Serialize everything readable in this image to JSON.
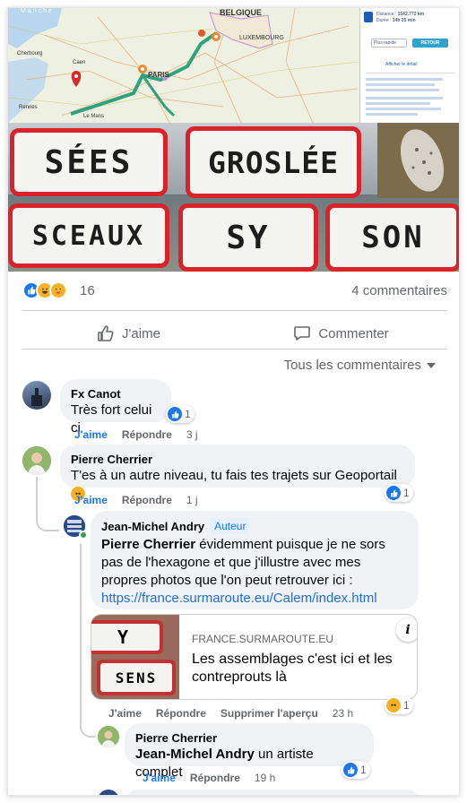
{
  "post": {
    "map_labels": {
      "belgique": "BELGIQUE",
      "luxembourg": "LUXEMBOURG",
      "paris": "PARIS",
      "le_mans": "Le Mans",
      "manche": "Manche",
      "caen": "Caen",
      "cherbourg": "Cherbourg",
      "rennes": "Rennes"
    },
    "map_panel": {
      "distance_label": "Distance :",
      "distance_value": "1542.772 km",
      "duration_label": "Durée :",
      "duration_value": "14h 25 min",
      "mode": "Plus rapide",
      "retour": "RETOUR",
      "detail": "Afficher le détail"
    },
    "signs": [
      "SÉES",
      "GROSLÉE",
      "SCEAUX",
      "SY",
      "SON"
    ]
  },
  "reactions": {
    "count": "16",
    "comments_count": "4 commentaires"
  },
  "actions": {
    "like": "J'aime",
    "comment": "Commenter"
  },
  "filter": {
    "label": "Tous les commentaires"
  },
  "comments": [
    {
      "author": "Fx Canot",
      "text": "Très fort celui ci",
      "reactions": "1",
      "like": "J'aime",
      "reply": "Répondre",
      "time": "3 j"
    },
    {
      "author": "Pierre Cherrier",
      "text": "T'es à un autre niveau, tu fais tes trajets sur Geoportail",
      "reactions": "1",
      "like": "J'aime",
      "reply": "Répondre",
      "time": "1 j"
    },
    {
      "author": "Jean-Michel Andry",
      "badge": "Auteur",
      "mention": "Pierre Cherrier",
      "text": " évidemment puisque je ne sors pas de l'hexagone et que j'illustre avec mes propres photos que l'on peut retrouver ici :",
      "link": "https://france.surmaroute.eu/Calem/index.html",
      "reactions": "1",
      "like": "J'aime",
      "reply": "Répondre",
      "remove_preview": "Supprimer l'aperçu",
      "time": "23 h"
    },
    {
      "author": "Pierre Cherrier",
      "mention": "Jean-Michel Andry",
      "text": " un artiste complet",
      "reactions": "1",
      "like": "J'aime",
      "reply": "Répondre",
      "time": "19 h"
    }
  ],
  "preview": {
    "domain": "FRANCE.SURMAROUTE.EU",
    "title": "Les assemblages c'est ici et les contreprouts là",
    "thumb_top": "Y",
    "thumb_bottom": "SENS",
    "info": "i"
  }
}
